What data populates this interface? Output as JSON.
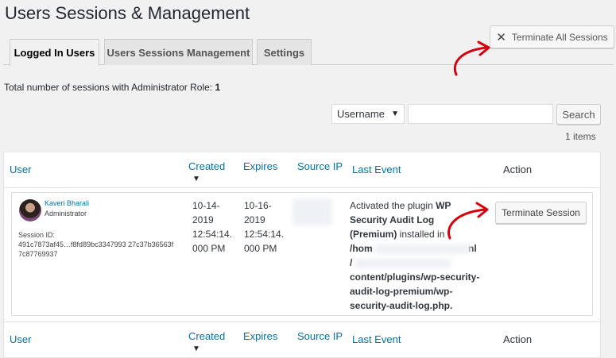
{
  "page": {
    "title": "Users Sessions & Management"
  },
  "tabs": [
    {
      "label": "Logged In Users",
      "active": true
    },
    {
      "label": "Users Sessions Management",
      "active": false
    },
    {
      "label": "Settings",
      "active": false
    }
  ],
  "actions": {
    "terminate_all_label": "Terminate All Sessions"
  },
  "summary": {
    "text": "Total number of sessions with Administrator Role:",
    "count": "1"
  },
  "filter": {
    "select_value": "Username",
    "search_value": "",
    "search_button": "Search"
  },
  "items_count": "1 items",
  "table": {
    "columns": [
      "User",
      "Created",
      "Expires",
      "Source IP",
      "Last Event",
      "Action"
    ],
    "sorted_column": "Created",
    "rows": [
      {
        "user_name": "Kaveri Bharali",
        "user_role": "Administrator",
        "session_label": "Session ID:",
        "session_id": "491c7873af45…f8fd89bc3347993 27c37b36563f7c87769937",
        "created": [
          "10-14-",
          "2019",
          "12:54:14.",
          "000 PM"
        ],
        "expires": [
          "10-16-",
          "2019",
          "12:54:14.",
          "000 PM"
        ],
        "source_ip": "",
        "last_event": {
          "prefix": "Activated the plugin ",
          "plugin": "WP Security Audit Log (Premium)",
          "mid": " installed in",
          "path_parts": [
            "/hom",
            "nl",
            "/",
            "content/plugins/wp-security-",
            "audit-log-premium/wp-",
            "security-audit-log.php."
          ]
        },
        "action_label": "Terminate Session"
      }
    ]
  },
  "colors": {
    "link": "#0073aa",
    "annotation_arrow": "#d9000d",
    "background": "#f1f1f1"
  },
  "icons": {
    "terminate_all": "x-icon",
    "dropdown": "caret-down-icon",
    "sort": "sort-down-icon"
  }
}
